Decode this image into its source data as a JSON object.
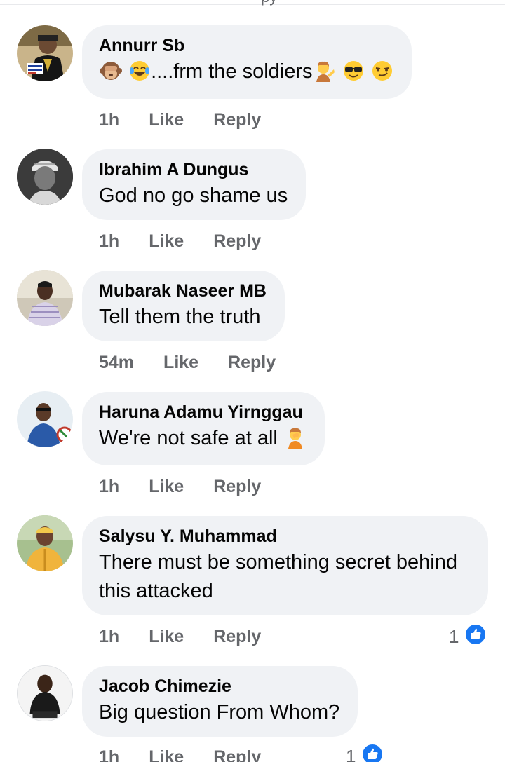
{
  "top_fragment": "py",
  "comments": [
    {
      "author": "Annurr Sb",
      "text": "....frm the soldiers",
      "time": "1h",
      "like": "Like",
      "reply": "Reply",
      "emojis_before": [
        "monkey-see-no-evil",
        "face-with-tears-of-joy"
      ],
      "emojis_after": [
        "person-tipping-hand",
        "smiling-face-with-sunglasses",
        "smirking-face"
      ]
    },
    {
      "author": "Ibrahim A Dungus",
      "text": "God no go shame us",
      "time": "1h",
      "like": "Like",
      "reply": "Reply"
    },
    {
      "author": "Mubarak Naseer MB",
      "text": "Tell them the truth",
      "time": "54m",
      "like": "Like",
      "reply": "Reply"
    },
    {
      "author": "Haruna Adamu Yirnggau",
      "text": " We're not safe at all",
      "time": "1h",
      "like": "Like",
      "reply": "Reply",
      "emojis_after": [
        "person-facepalming"
      ]
    },
    {
      "author": "Salysu Y. Muhammad",
      "text": "There must be something secret behind this attacked",
      "time": "1h",
      "like": "Like",
      "reply": "Reply",
      "reaction_count": "1",
      "reaction_icon": "like-reaction-icon"
    },
    {
      "author": "Jacob Chimezie",
      "text": "Big question From Whom?",
      "time": "1h",
      "like": "Like",
      "reply": "Reply",
      "reaction_count": "1",
      "reaction_icon": "like-reaction-icon"
    }
  ],
  "colors": {
    "bubble": "#f0f2f5",
    "text": "#050505",
    "secondary": "#65676b",
    "like_blue": "#1877f2"
  }
}
